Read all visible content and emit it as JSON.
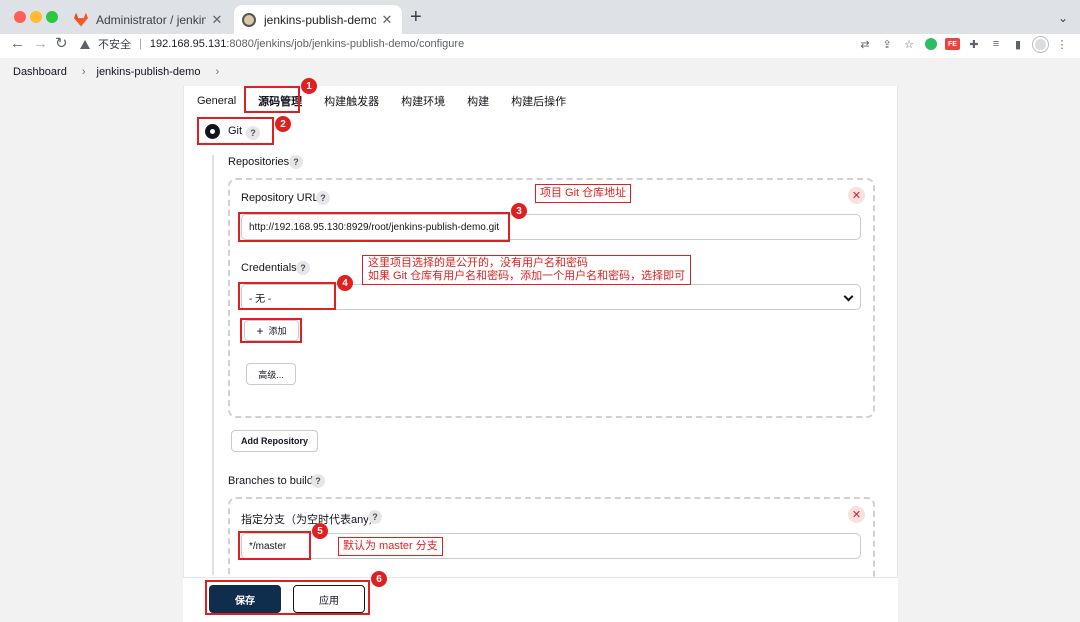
{
  "browser": {
    "tabs": [
      {
        "title": "Administrator / jenkins-publish",
        "close": "✕"
      },
      {
        "title": "jenkins-publish-demo Config [",
        "close": "✕"
      }
    ],
    "new_tab": "+",
    "tab_menu": "⌄",
    "insecure_label": "不安全",
    "url_separator": "|",
    "url_host": "192.168.95.131",
    "url_rest": ":8080/jenkins/job/jenkins-publish-demo/configure",
    "icons": [
      "translate-icon",
      "share-icon",
      "star-icon",
      "evernote-icon",
      "fe-extension-icon",
      "extensions-icon",
      "media-icon",
      "sidebar-icon",
      "avatar"
    ]
  },
  "breadcrumb": {
    "items": [
      "Dashboard",
      "jenkins-publish-demo"
    ],
    "separator": "›"
  },
  "config": {
    "tabs": [
      "General",
      "源码管理",
      "构建触发器",
      "构建环境",
      "构建",
      "构建后操作"
    ],
    "active_tab": "源码管理",
    "scm_option": "Git",
    "help": "?",
    "repositories_label": "Repositories",
    "repo": {
      "url_label": "Repository URL",
      "url_value": "http://192.168.95.130:8929/root/jenkins-publish-demo.git",
      "credentials_label": "Credentials",
      "credentials_value": "- 无 -",
      "add_button": "添加",
      "add_icon": "+",
      "advanced_button": "高级...",
      "delete_icon": "✕"
    },
    "add_repository_button": "Add Repository",
    "branches_label": "Branches to build",
    "branch": {
      "label": "指定分支（为空时代表any）",
      "value": "*/master",
      "delete_icon": "✕"
    },
    "save_button": "保存",
    "apply_button": "应用"
  },
  "annotations": {
    "badges": [
      "1",
      "2",
      "3",
      "4",
      "5",
      "6"
    ],
    "note_repo": "项目 Git 仓库地址",
    "note_credentials_1": "这里项目选择的是公开的，没有用户名和密码",
    "note_credentials_2": "如果 Git 仓库有用户名和密码，添加一个用户名和密码，选择即可",
    "note_branch": "默认为 master 分支",
    "color": "#e02020"
  }
}
